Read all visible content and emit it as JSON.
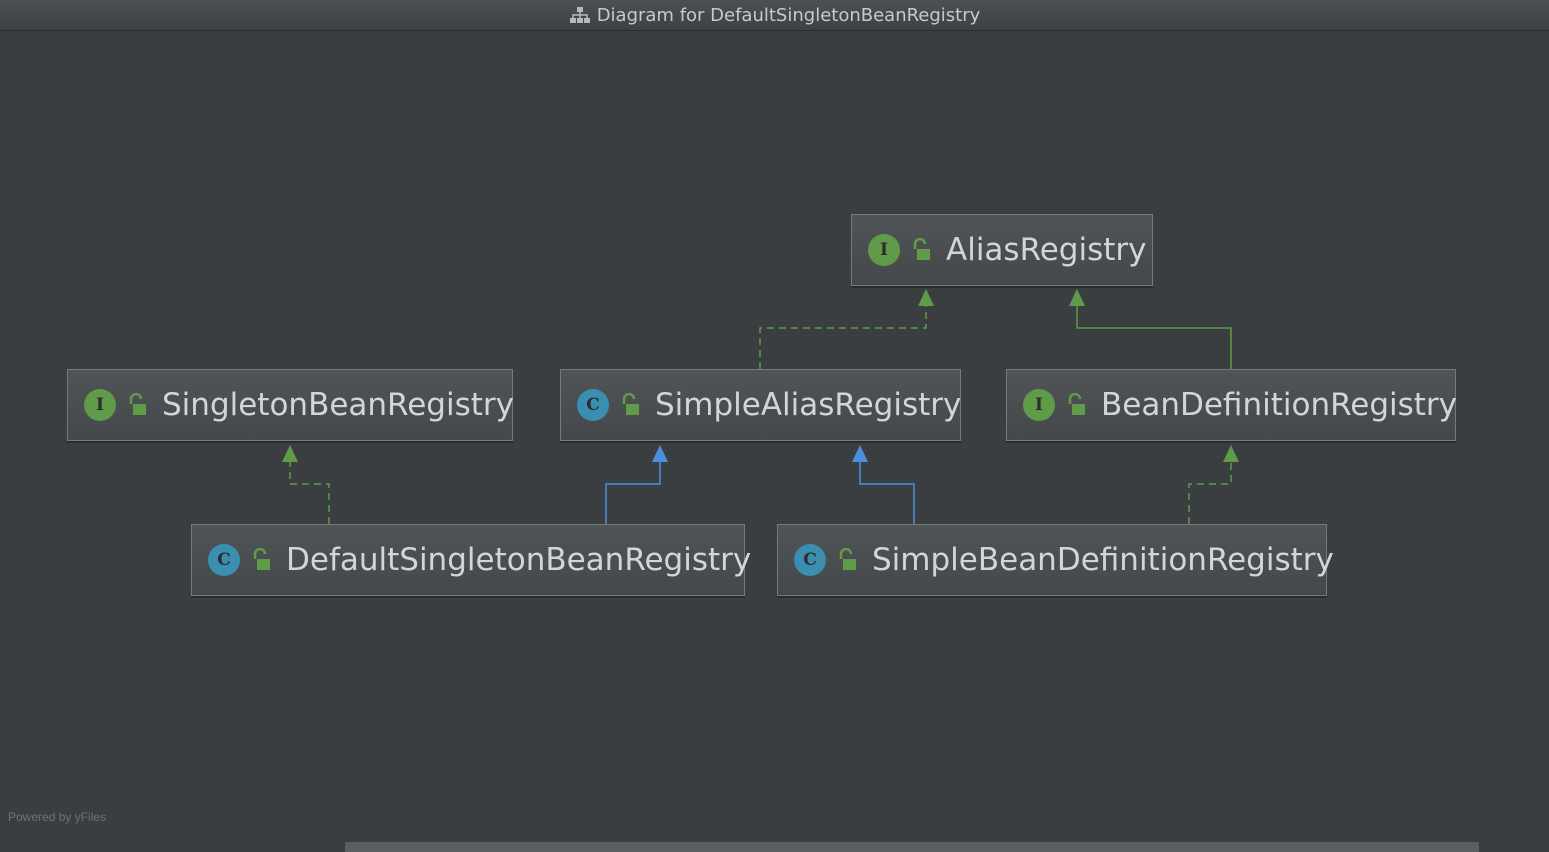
{
  "window": {
    "title": "Diagram for DefaultSingletonBeanRegistry",
    "title_icon": "hierarchy-diagram-icon"
  },
  "nodes": {
    "alias_registry": {
      "name": "AliasRegistry",
      "kind": "interface",
      "badge": "I"
    },
    "singleton_bean_registry": {
      "name": "SingletonBeanRegistry",
      "kind": "interface",
      "badge": "I"
    },
    "simple_alias_registry": {
      "name": "SimpleAliasRegistry",
      "kind": "class",
      "badge": "C"
    },
    "bean_definition_registry": {
      "name": "BeanDefinitionRegistry",
      "kind": "interface",
      "badge": "I"
    },
    "default_singleton_bean_registry": {
      "name": "DefaultSingletonBeanRegistry",
      "kind": "class",
      "badge": "C"
    },
    "simple_bean_definition_registry": {
      "name": "SimpleBeanDefinitionRegistry",
      "kind": "class",
      "badge": "C"
    }
  },
  "edges": [
    {
      "from": "SimpleAliasRegistry",
      "to": "AliasRegistry",
      "type": "implements",
      "style": "dashed"
    },
    {
      "from": "BeanDefinitionRegistry",
      "to": "AliasRegistry",
      "type": "extends",
      "style": "solid"
    },
    {
      "from": "DefaultSingletonBeanRegistry",
      "to": "SingletonBeanRegistry",
      "type": "implements",
      "style": "dashed"
    },
    {
      "from": "DefaultSingletonBeanRegistry",
      "to": "SimpleAliasRegistry",
      "type": "extends",
      "style": "solid"
    },
    {
      "from": "SimpleBeanDefinitionRegistry",
      "to": "SimpleAliasRegistry",
      "type": "extends",
      "style": "solid"
    },
    {
      "from": "SimpleBeanDefinitionRegistry",
      "to": "BeanDefinitionRegistry",
      "type": "implements",
      "style": "dashed"
    }
  ],
  "colors": {
    "background": "#3b3e40",
    "interface_edge": "#5f9b48",
    "class_edge": "#4a8fe0",
    "interface_badge": "#5f9b48",
    "class_badge": "#3a8fb1",
    "public_lock": "#5f9b48"
  },
  "footer": {
    "powered_by": "Powered by yFiles"
  }
}
